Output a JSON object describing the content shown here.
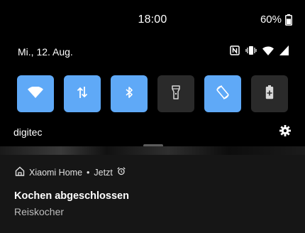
{
  "status_bar": {
    "time": "18:00",
    "battery_percent": "60%",
    "battery_level": 0.6,
    "battery_icon": "battery-icon"
  },
  "quick_settings": {
    "date": "Mi., 12. Aug.",
    "status_icons": [
      "nfc-icon",
      "vibrate-icon",
      "wifi-icon",
      "cell-signal-icon"
    ],
    "tiles": [
      {
        "icon": "wifi-icon",
        "active": true
      },
      {
        "icon": "mobile-data-icon",
        "active": true
      },
      {
        "icon": "bluetooth-icon",
        "active": true
      },
      {
        "icon": "flashlight-icon",
        "active": false
      },
      {
        "icon": "auto-rotate-icon",
        "active": true
      },
      {
        "icon": "battery-saver-icon",
        "active": false
      }
    ],
    "network_name": "digitec",
    "accent_color": "#5fa9f7",
    "inactive_color": "#2a2a2a"
  },
  "notification": {
    "app_name": "Xiaomi Home",
    "separator": "•",
    "time": "Jetzt",
    "title": "Kochen abgeschlossen",
    "text": "Reiskocher"
  }
}
